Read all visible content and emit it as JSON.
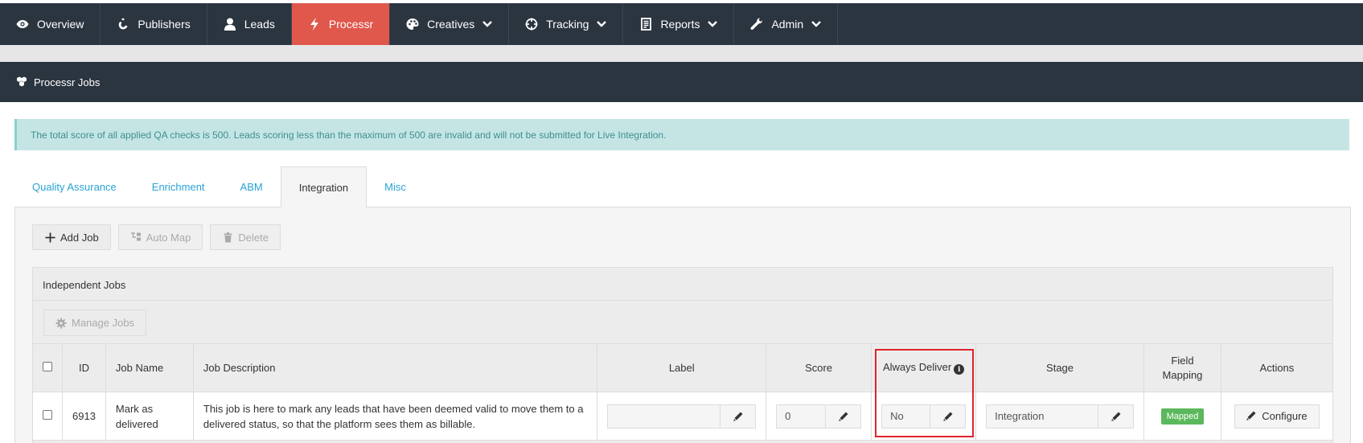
{
  "nav": {
    "items": [
      {
        "label": "Overview",
        "icon": "eye-icon",
        "dropdown": false
      },
      {
        "label": "Publishers",
        "icon": "publishers-icon",
        "dropdown": false
      },
      {
        "label": "Leads",
        "icon": "user-icon",
        "dropdown": false
      },
      {
        "label": "Processr",
        "icon": "bolt-icon",
        "dropdown": false,
        "active": true
      },
      {
        "label": "Creatives",
        "icon": "palette-icon",
        "dropdown": true
      },
      {
        "label": "Tracking",
        "icon": "crosshair-icon",
        "dropdown": true
      },
      {
        "label": "Reports",
        "icon": "report-icon",
        "dropdown": true
      },
      {
        "label": "Admin",
        "icon": "wrench-icon",
        "dropdown": true
      }
    ],
    "active_color": "#e0574c",
    "bg_color": "#2b3540"
  },
  "subheader": {
    "title": "Processr Jobs"
  },
  "alert": {
    "text": "The total score of all applied QA checks is 500. Leads scoring less than the maximum of 500 are invalid and will not be submitted for Live Integration."
  },
  "tabs": [
    "Quality Assurance",
    "Enrichment",
    "ABM",
    "Integration",
    "Misc"
  ],
  "active_tab": "Integration",
  "toolbar": {
    "add_job": "Add Job",
    "auto_map": "Auto Map",
    "delete": "Delete"
  },
  "jobs": {
    "title": "Independent Jobs",
    "manage_label": "Manage Jobs",
    "columns": {
      "id": "ID",
      "job_name": "Job Name",
      "job_description": "Job Description",
      "label": "Label",
      "score": "Score",
      "always_deliver": "Always Deliver",
      "stage": "Stage",
      "field_mapping": "Field Mapping",
      "actions": "Actions"
    },
    "rows": [
      {
        "id": "6913",
        "name": "Mark as delivered",
        "description": "This job is here to mark any leads that have been deemed valid to move them to a delivered status, so that the platform sees them as billable.",
        "label": "",
        "score": "0",
        "always_deliver": "No",
        "stage": "Integration",
        "mapping": "Mapped",
        "action": "Configure"
      }
    ]
  }
}
